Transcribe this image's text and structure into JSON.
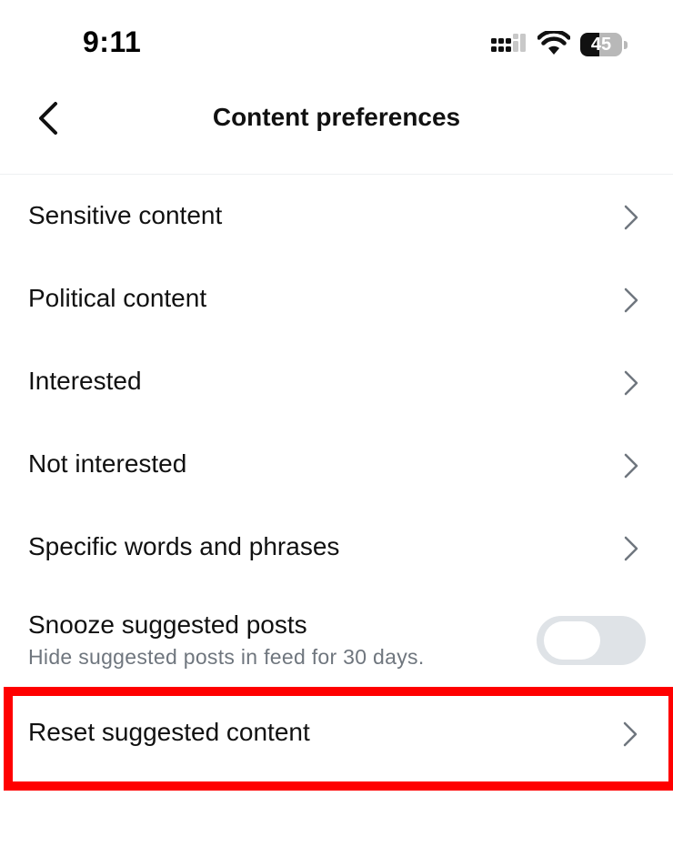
{
  "status_bar": {
    "time": "9:11",
    "battery_level": "45",
    "icons": [
      "signal-icon",
      "wifi-icon",
      "battery-icon"
    ]
  },
  "header": {
    "title": "Content preferences",
    "back_icon": "chevron-left-icon"
  },
  "menu": {
    "items": [
      {
        "label": "Sensitive content"
      },
      {
        "label": "Political content"
      },
      {
        "label": "Interested"
      },
      {
        "label": "Not interested"
      },
      {
        "label": "Specific words and phrases"
      }
    ]
  },
  "snooze": {
    "title": "Snooze suggested posts",
    "subtitle": "Hide suggested posts in feed for 30 days.",
    "enabled": false
  },
  "reset": {
    "label": "Reset suggested content",
    "highlight_color": "#ff0000"
  },
  "colors": {
    "text_primary": "#111111",
    "text_secondary": "#6f767e",
    "chevron": "#6f767e",
    "toggle_off": "#dfe3e7"
  }
}
